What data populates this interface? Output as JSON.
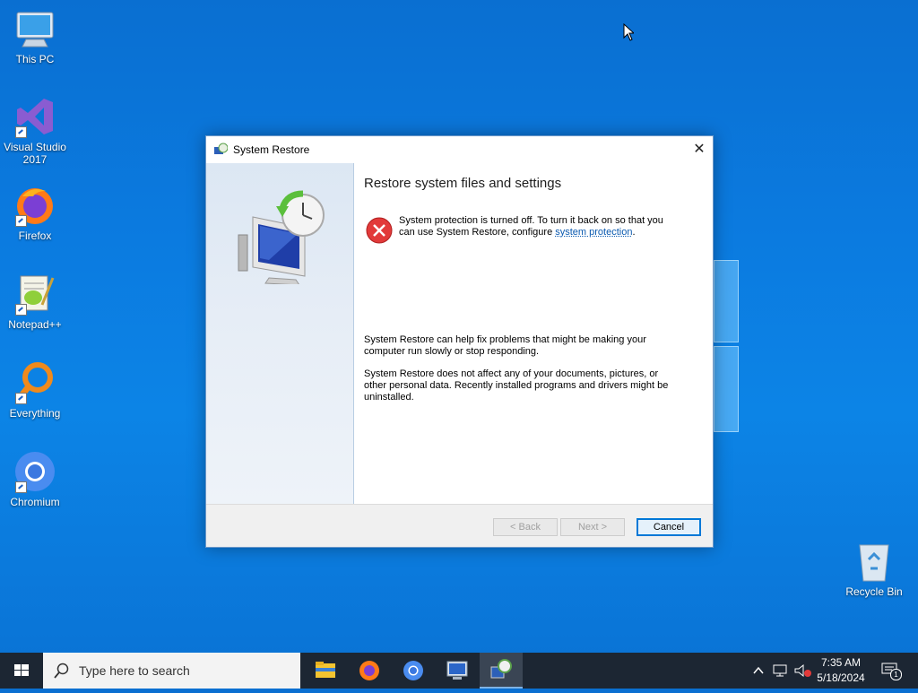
{
  "desktop": {
    "icons": [
      {
        "label": "This PC"
      },
      {
        "label": "Visual Studio 2017"
      },
      {
        "label": "Firefox"
      },
      {
        "label": "Notepad++"
      },
      {
        "label": "Everything"
      },
      {
        "label": "Chromium"
      },
      {
        "label": "Recycle Bin"
      }
    ]
  },
  "dialog": {
    "title": "System Restore",
    "close_glyph": "✕",
    "heading": "Restore system files and settings",
    "error_text_1": "System protection is turned off. To turn it back on so that you can use System Restore, configure ",
    "error_link": "system protection",
    "error_text_2": ".",
    "info_1": "System Restore can help fix problems that might be making your computer run slowly or stop responding.",
    "info_2": "System Restore does not affect any of your documents, pictures, or other personal data. Recently installed programs and drivers might be uninstalled.",
    "buttons": {
      "back": "< Back",
      "next": "Next >",
      "cancel": "Cancel"
    }
  },
  "taskbar": {
    "search_placeholder": "Type here to search",
    "apps": [
      {
        "icon": "file-explorer-icon"
      },
      {
        "icon": "firefox-icon"
      },
      {
        "icon": "chromium-icon"
      },
      {
        "icon": "remote-desktop-icon"
      },
      {
        "icon": "system-restore-icon"
      }
    ],
    "clock_time": "7:35 AM",
    "clock_date": "5/18/2024",
    "notification_count": "1"
  },
  "colors": {
    "accent": "#0078d7",
    "desktop_blue": "#0b7be0",
    "taskbar": "#1c2633",
    "error_red": "#e23a3a"
  }
}
